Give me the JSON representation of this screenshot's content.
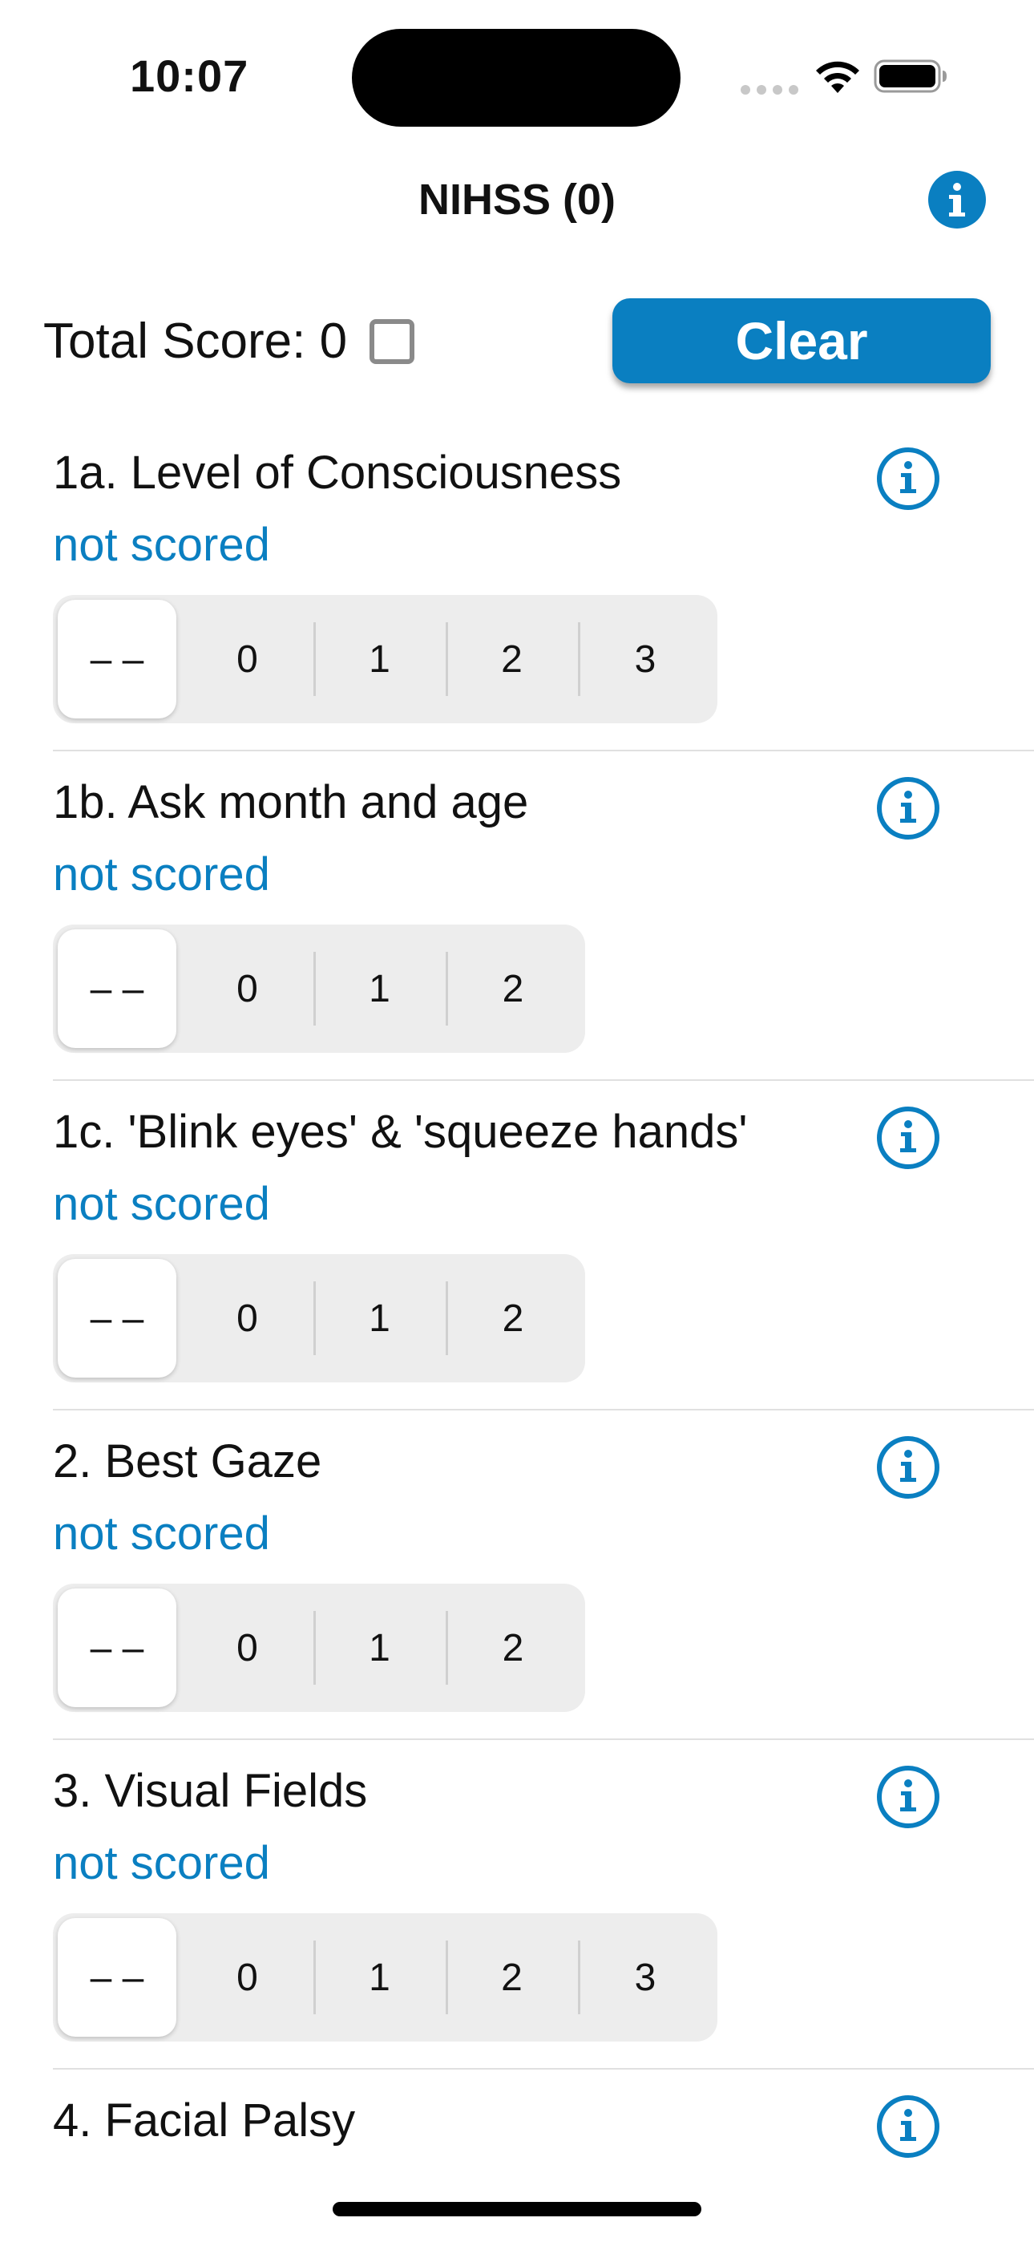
{
  "status_bar": {
    "time": "10:07"
  },
  "nav": {
    "title": "NIHSS (0)",
    "info_icon": "info-filled-icon"
  },
  "header": {
    "total_score_label": "Total Score: 0",
    "clear_label": "Clear"
  },
  "colors": {
    "accent": "#0a7fc1",
    "segment_bg": "#ededed",
    "divider": "#e0e0e0"
  },
  "items": [
    {
      "title": "1a. Level of Consciousness",
      "status": "not scored",
      "options": [
        "– –",
        "0",
        "1",
        "2",
        "3"
      ],
      "selected": "– –"
    },
    {
      "title": "1b. Ask month and age",
      "status": "not scored",
      "options": [
        "– –",
        "0",
        "1",
        "2"
      ],
      "selected": "– –"
    },
    {
      "title": "1c. 'Blink eyes' & 'squeeze hands'",
      "status": "not scored",
      "options": [
        "– –",
        "0",
        "1",
        "2"
      ],
      "selected": "– –"
    },
    {
      "title": "2. Best Gaze",
      "status": "not scored",
      "options": [
        "– –",
        "0",
        "1",
        "2"
      ],
      "selected": "– –"
    },
    {
      "title": "3. Visual Fields",
      "status": "not scored",
      "options": [
        "– –",
        "0",
        "1",
        "2",
        "3"
      ],
      "selected": "– –"
    },
    {
      "title": "4. Facial Palsy"
    }
  ]
}
